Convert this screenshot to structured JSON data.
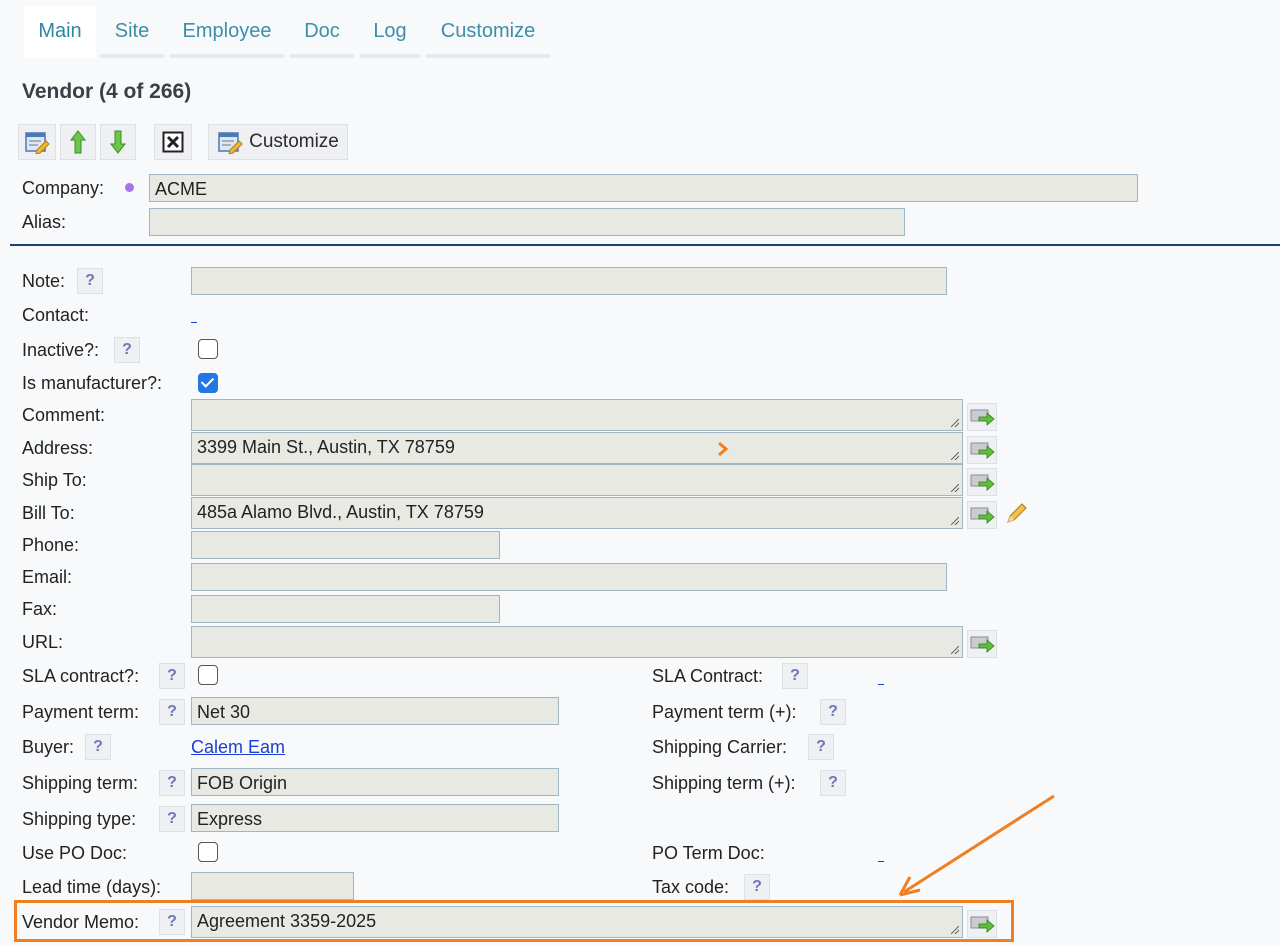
{
  "tabs": [
    "Main",
    "Site",
    "Employee",
    "Doc",
    "Log",
    "Customize"
  ],
  "title": "Vendor (4 of 266)",
  "toolbar": {
    "customize_label": "Customize"
  },
  "header": {
    "company_label": "Company:",
    "company_value": "ACME",
    "alias_label": "Alias:",
    "alias_value": ""
  },
  "form": {
    "note_label": "Note:",
    "contact_label": "Contact:",
    "inactive_label": "Inactive?:",
    "manufacturer_label": "Is manufacturer?:",
    "comment_label": "Comment:",
    "address_label": "Address:",
    "address_value": "3399 Main St., Austin, TX 78759",
    "shipto_label": "Ship To:",
    "billto_label": "Bill To:",
    "billto_value": "485a Alamo Blvd., Austin, TX 78759",
    "phone_label": "Phone:",
    "email_label": "Email:",
    "fax_label": "Fax:",
    "url_label": "URL:",
    "sla_label": "SLA contract?:",
    "sla_contract_label": "SLA Contract:",
    "payment_term_label": "Payment term:",
    "payment_term_value": "Net 30",
    "payment_term_plus_label": "Payment term (+):",
    "buyer_label": "Buyer:",
    "buyer_value": "Calem Eam",
    "shipping_carrier_label": "Shipping Carrier:",
    "shipping_term_label": "Shipping term:",
    "shipping_term_value": "FOB Origin",
    "shipping_term_plus_label": "Shipping term (+):",
    "shipping_type_label": "Shipping type:",
    "shipping_type_value": "Express",
    "use_po_doc_label": "Use PO Doc:",
    "po_term_doc_label": "PO Term Doc:",
    "lead_time_label": "Lead time (days):",
    "tax_code_label": "Tax code:",
    "vendor_memo_label": "Vendor Memo:",
    "vendor_memo_value": "Agreement 3359-2025"
  },
  "colors": {
    "accent": "#3d8fa8",
    "highlight": "#f07f22",
    "link": "#1a3fd6"
  }
}
